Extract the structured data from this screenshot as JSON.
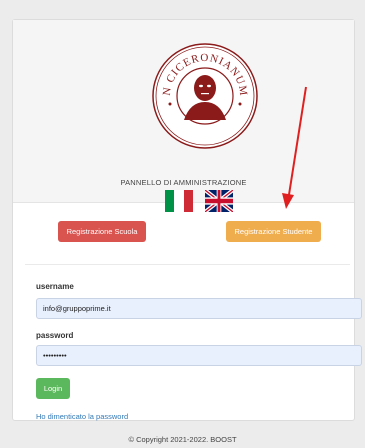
{
  "header": {
    "logo_text": "CERTAMEN CICERONIANUM ARPINAS",
    "panel_title": "PANNELLO DI AMMINISTRAZIONE",
    "flags": [
      "italian-flag-icon",
      "uk-flag-icon"
    ]
  },
  "actions": {
    "register_school_label": "Registrazione Scuola",
    "register_student_label": "Registrazione Studente"
  },
  "form": {
    "username_label": "username",
    "username_value": "info@gruppoprime.it",
    "password_label": "password",
    "password_value": "•••••••••",
    "login_label": "Login",
    "forgot_label": "Ho dimenticato la password"
  },
  "footer": {
    "copyright": "© Copyright 2021-2022. BOOST"
  },
  "colors": {
    "school_button": "#d9534f",
    "student_button": "#f0ad4e",
    "login_button": "#5cb85c",
    "link": "#337ab7",
    "logo": "#8b1a1a",
    "annotation_arrow": "#e02020"
  }
}
